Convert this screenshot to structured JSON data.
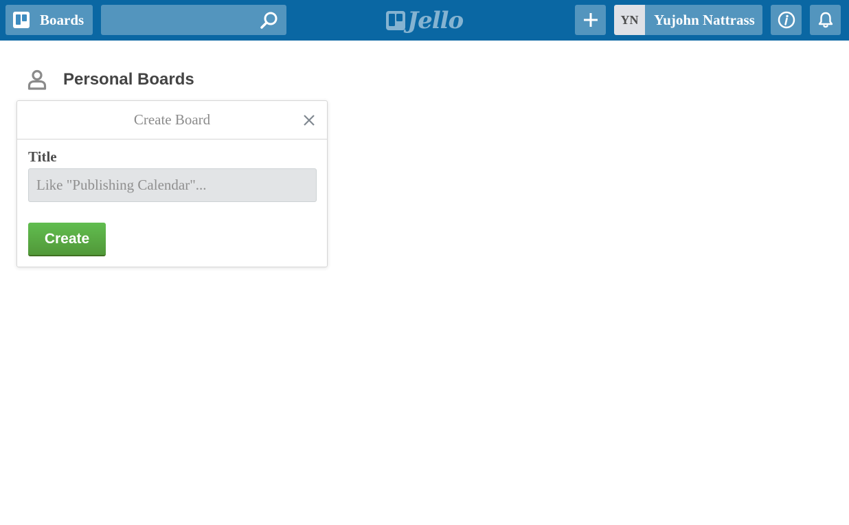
{
  "header": {
    "boards_label": "Boards",
    "search_placeholder": "",
    "logo_text": "Jello",
    "user_initials": "YN",
    "user_name": "Yujohn Nattrass"
  },
  "section": {
    "title": "Personal Boards"
  },
  "create_board_popover": {
    "title": "Create Board",
    "field_label": "Title",
    "title_placeholder": "Like \"Publishing Calendar\"...",
    "title_value": "",
    "create_label": "Create"
  },
  "colors": {
    "header_bg": "#0a67a3",
    "create_button": "#5aac44"
  },
  "icons": {
    "boards": "boards-icon",
    "search": "search-icon",
    "logo": "jello-logo-icon",
    "add": "plus-icon",
    "info": "info-icon",
    "notifications": "bell-icon",
    "section": "person-icon",
    "close": "close-icon"
  }
}
